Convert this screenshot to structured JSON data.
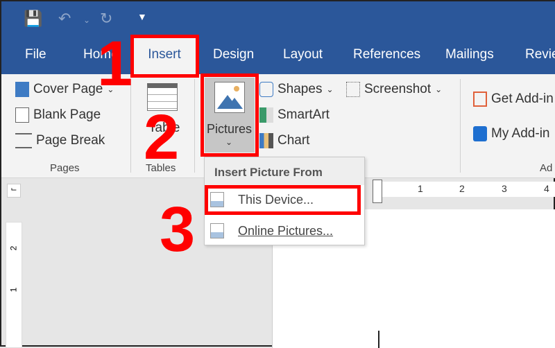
{
  "quick_access": {
    "save_icon": "save-icon",
    "undo_icon": "undo-icon",
    "redo_icon": "redo-icon",
    "customize_icon": "customize-icon"
  },
  "tabs": [
    "File",
    "Home",
    "Insert",
    "Design",
    "Layout",
    "References",
    "Mailings",
    "Revie"
  ],
  "active_tab": "Insert",
  "ribbon": {
    "pages": {
      "items": [
        "Cover Page",
        "Blank Page",
        "Page Break"
      ],
      "label": "Pages"
    },
    "tables": {
      "button": "Table",
      "label": "Tables"
    },
    "pictures": {
      "button": "Pictures"
    },
    "illustrations": {
      "items": [
        "Shapes",
        "SmartArt",
        "Chart"
      ],
      "screenshot": "Screenshot"
    },
    "addins": {
      "items": [
        "Get Add-in",
        "My Add-in"
      ],
      "label": "Ad"
    }
  },
  "menu": {
    "header": "Insert Picture From",
    "items": [
      "This Device...",
      "Online Pictures..."
    ]
  },
  "ruler": {
    "numbers": [
      "1",
      "2",
      "3",
      "4"
    ],
    "vertical": [
      "2",
      "1"
    ]
  },
  "annotations": {
    "steps": [
      "1",
      "2",
      "3"
    ],
    "color": "#ff0000"
  },
  "colors": {
    "title_bar": "#2b579a",
    "ribbon": "#f3f3f3"
  }
}
